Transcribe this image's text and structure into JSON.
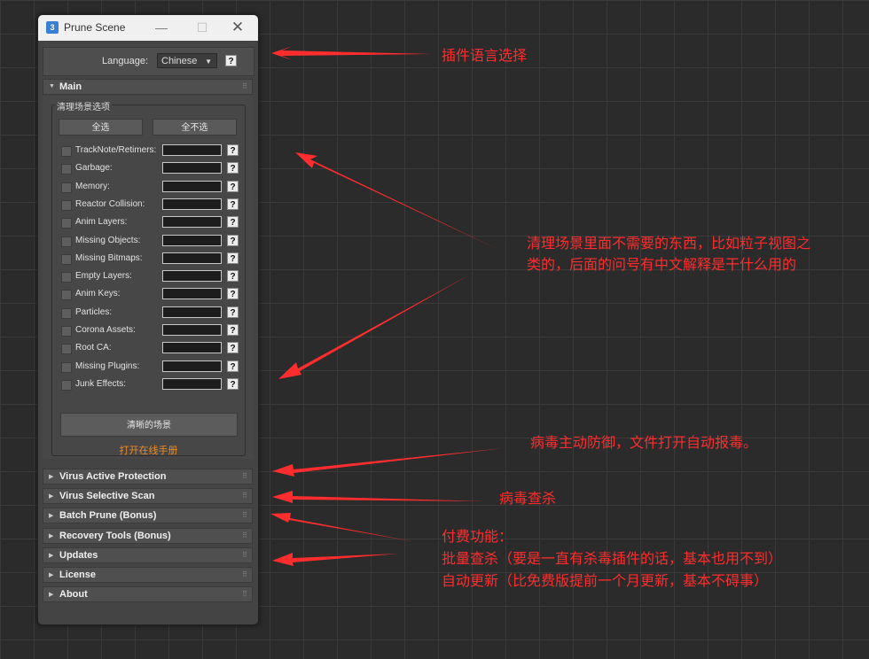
{
  "window": {
    "app_icon": "3",
    "title": "Prune Scene",
    "controls": {
      "minimize": "—",
      "maximize": "☐",
      "close": "✕"
    }
  },
  "language": {
    "label": "Language:",
    "value": "Chinese",
    "help": "?"
  },
  "main": {
    "title": "Main",
    "group_title": "清理场景选项",
    "select_all": "全选",
    "select_none": "全不选",
    "options": [
      "TrackNote/Retimers:",
      "Garbage:",
      "Memory:",
      "Reactor Collision:",
      "Anim Layers:",
      "Missing Objects:",
      "Missing Bitmaps:",
      "Empty Layers:",
      "Anim Keys:",
      "Particles:",
      "Corona Assets:",
      "Root CA:",
      "Missing Plugins:",
      "Junk Effects:"
    ],
    "help": "?",
    "clear_button": "清晰的场景",
    "manual_link": "打开在线手册"
  },
  "rollouts": [
    "Virus Active Protection",
    "Virus Selective Scan",
    "Batch Prune (Bonus)",
    "Recovery Tools (Bonus)",
    "Updates",
    "License",
    "About"
  ],
  "annotations": {
    "lang": "插件语言选择",
    "clean_line1": "清理场景里面不需要的东西，比如粒子视图之",
    "clean_line2": "类的，后面的问号有中文解释是干什么用的",
    "virus_protect": "病毒主动防御，文件打开自动报毒。",
    "virus_scan": "病毒查杀",
    "paid_line1": "付费功能：",
    "paid_line2": "批量查杀（要是一直有杀毒插件的话，基本也用不到）",
    "paid_line3": "自动更新（比免费版提前一个月更新，基本不碍事）"
  },
  "colors": {
    "annotation": "#ff2d2d",
    "link": "#f08a24",
    "panel": "#444444"
  }
}
